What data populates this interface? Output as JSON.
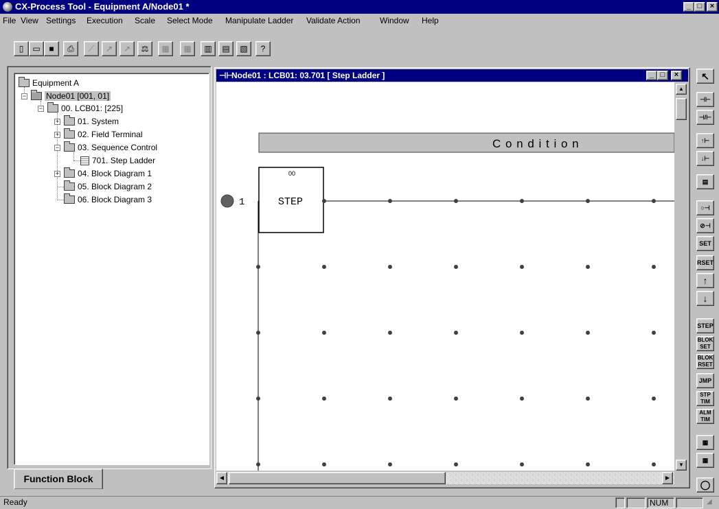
{
  "window": {
    "title": "CX-Process Tool - Equipment A/Node01 *"
  },
  "menu": [
    "File",
    "View",
    "Settings",
    "Execution",
    "Scale",
    "Select Mode",
    "Manipulate Ladder",
    "Validate Action",
    "Window",
    "Help"
  ],
  "tree": {
    "root": "Equipment A",
    "node": "Node01 [001, 01]",
    "lcb": "00. LCB01: [225]",
    "items": [
      "01. System",
      "02. Field Terminal",
      "03. Sequence Control",
      "701. Step Ladder",
      "04. Block Diagram 1",
      "05. Block Diagram 2",
      "06. Block Diagram 3"
    ]
  },
  "tab_label": "Function Block",
  "child": {
    "title": "Node01 : LCB01: 03.701 [ Step Ladder ]",
    "condition_label": "C o n d i t i o n",
    "step_number": "00",
    "step_label": "STEP",
    "rung_number": "1"
  },
  "palette": [
    "SET",
    "RSET",
    "↑",
    "↓",
    "STEP",
    "BLOK SET",
    "BLOK RSET",
    "JMP",
    "STP TIM",
    "ALM TIM"
  ],
  "status": {
    "text": "Ready",
    "num": "NUM"
  },
  "colors": {
    "titlebar": "#000080",
    "face": "#c0c0c0",
    "canvas": "#ffffff"
  }
}
